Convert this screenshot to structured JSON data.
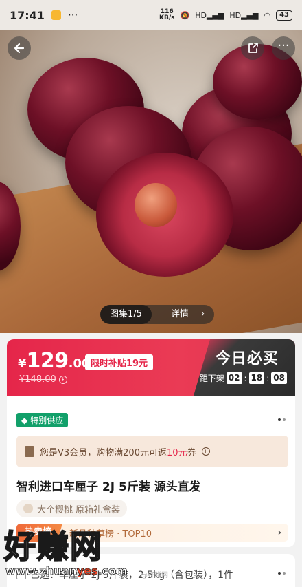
{
  "status_bar": {
    "time": "17:41",
    "net_speed_value": "116",
    "net_speed_unit": "KB/s",
    "signal1": "HD",
    "signal2": "HD",
    "battery": "43"
  },
  "gallery": {
    "tab_album": "图集1/5",
    "tab_detail": "详情"
  },
  "price": {
    "currency": "¥",
    "integer": "129",
    "decimal": ".00",
    "subsidy_label": "限时补贴19元",
    "original": "¥148.00"
  },
  "today": {
    "title": "今日必买",
    "countdown_label": "距下架",
    "hours": "02",
    "minutes": "18",
    "seconds": "08",
    "sep": ":"
  },
  "product": {
    "special_badge": "特别供应",
    "coupon_text_prefix": "您是V3会员，购物满200元可返",
    "coupon_amount": "10元",
    "coupon_suffix": "券",
    "title": "智利进口车厘子 2J 5斤装 源头直发",
    "tag_chip": "大个樱桃 原箱礼盒装",
    "rank_hot": "热卖榜",
    "rank_text": "新品种草榜 · TOP10",
    "rank_arrow": "›"
  },
  "spec": {
    "line": "已选：车厘子 2J 5斤装，2.5kg（含包装），1件"
  },
  "watermark": {
    "big": "好赚网",
    "url_a": "www.zhuan",
    "url_hl": "yes",
    "url_b": ".com",
    "small": "@好赚网"
  },
  "colors": {
    "accent": "#e5264a",
    "special_green": "#12a06a",
    "hot_orange": "#f06a3a"
  }
}
